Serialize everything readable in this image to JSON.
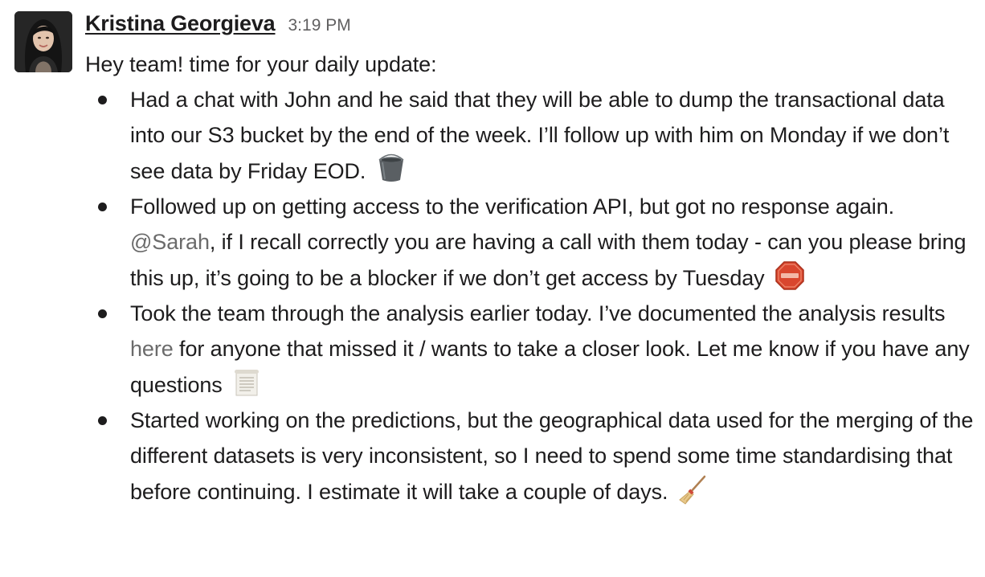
{
  "message": {
    "author": "Kristina Georgieva",
    "timestamp": "3:19 PM",
    "intro": "Hey team! time for your daily update:",
    "bullets": [
      {
        "text": "Had a chat with John and he said that they will be able to dump the transactional data into our S3 bucket by the end of the week. I’ll follow up with him on Monday if we don’t see data by Friday EOD.",
        "emoji": "bucket-icon"
      },
      {
        "text_before": "Followed up on getting access to the verification API, but got no response again.",
        "mention": "@Sarah",
        "text_after": ", if I recall correctly you are having a call with them today - can you please bring this up, it’s going to be a blocker if we don’t get access by Tuesday",
        "emoji": "stop-sign-icon"
      },
      {
        "text_before": "Took the team through the analysis earlier today. I’ve documented the analysis results",
        "link": "here",
        "text_after": "for anyone that missed it / wants to take a closer look. Let me know if you have any questions",
        "emoji": "scroll-icon"
      },
      {
        "text": "Started working on the predictions, but the geographical data used for the merging of the different datasets is very inconsistent, so I need to spend some time standardising that before continuing. I estimate it will take a couple of days.",
        "emoji": "broom-icon"
      }
    ]
  },
  "colors": {
    "text": "#1d1c1d",
    "timestamp": "#616061",
    "link": "#6b6b6b",
    "stop_sign": "#d9462e",
    "bucket": "#5a5f63"
  }
}
